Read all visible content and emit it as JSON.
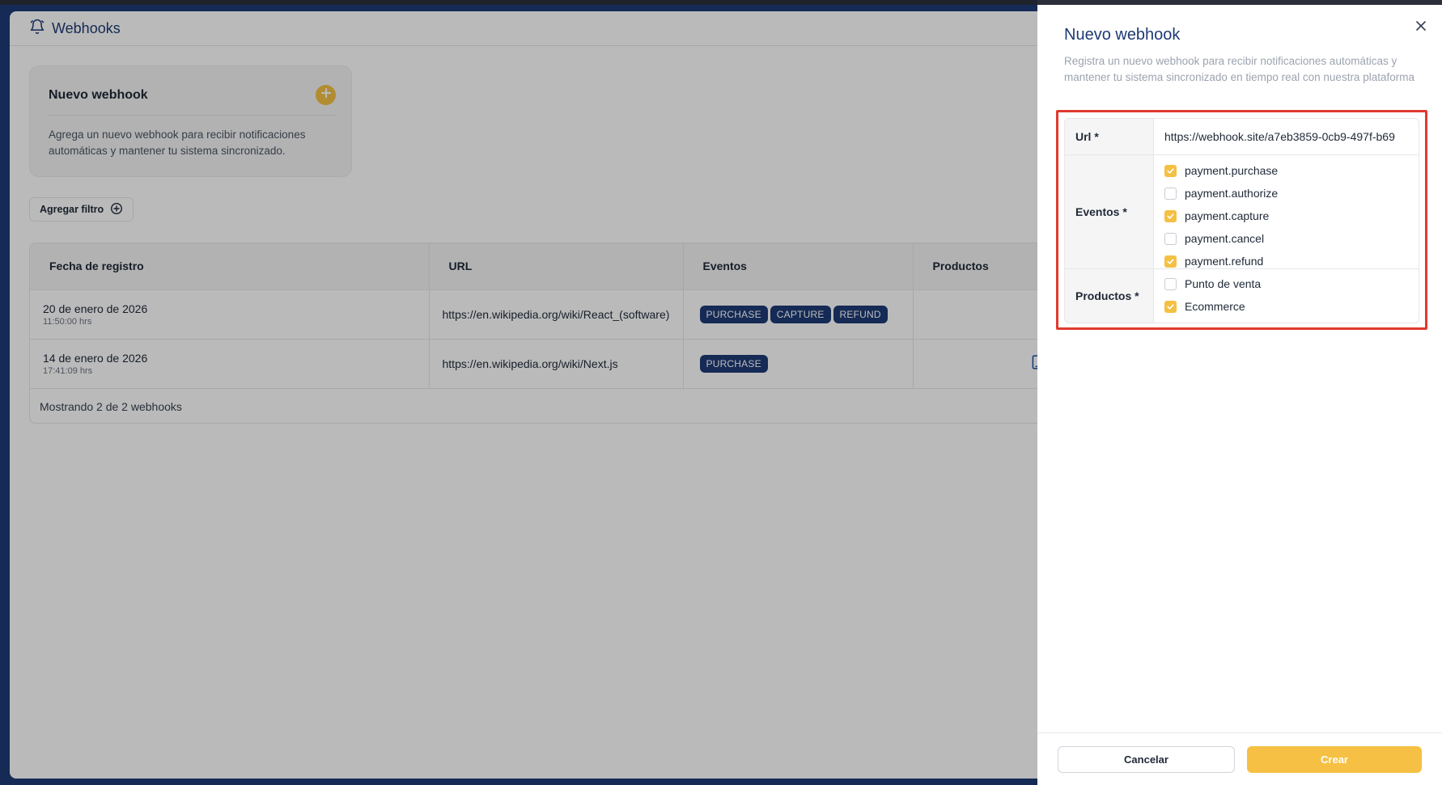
{
  "colors": {
    "brand": "#1e3a75",
    "accent": "#f5c043",
    "highlight": "#e03a2f"
  },
  "header": {
    "title": "Webhooks",
    "icon": "bell-icon"
  },
  "new_card": {
    "title": "Nuevo webhook",
    "description": "Agrega un nuevo webhook para recibir notificaciones automáticas y mantener tu sistema sincronizado.",
    "icon": "plus-icon"
  },
  "filter": {
    "label": "Agregar filtro",
    "icon": "plus-circle-icon"
  },
  "table": {
    "columns": [
      "Fecha de registro",
      "URL",
      "Eventos",
      "Productos"
    ],
    "rows": [
      {
        "date": "20 de enero de 2026",
        "time": "11:50:00 hrs",
        "url": "https://en.wikipedia.org/wiki/React_(software)",
        "events": [
          "PURCHASE",
          "CAPTURE",
          "REFUND"
        ],
        "products": [
          "cart-icon"
        ]
      },
      {
        "date": "14 de enero de 2026",
        "time": "17:41:09 hrs",
        "url": "https://en.wikipedia.org/wiki/Next.js",
        "events": [
          "PURCHASE"
        ],
        "products": [
          "phone-icon",
          "cart-icon"
        ]
      }
    ],
    "footer": "Mostrando 2 de 2 webhooks"
  },
  "drawer": {
    "title": "Nuevo webhook",
    "description": "Registra un nuevo webhook para recibir notificaciones automáticas y mantener tu sistema sincronizado en tiempo real con nuestra plataforma",
    "form": {
      "url_label": "Url *",
      "url_value": "https://webhook.site/a7eb3859-0cb9-497f-b69",
      "events_label": "Eventos *",
      "events": [
        {
          "label": "payment.purchase",
          "checked": true
        },
        {
          "label": "payment.authorize",
          "checked": false
        },
        {
          "label": "payment.capture",
          "checked": true
        },
        {
          "label": "payment.cancel",
          "checked": false
        },
        {
          "label": "payment.refund",
          "checked": true
        }
      ],
      "products_label": "Productos *",
      "products": [
        {
          "label": "Punto de venta",
          "checked": false
        },
        {
          "label": "Ecommerce",
          "checked": true
        }
      ]
    },
    "cancel_label": "Cancelar",
    "create_label": "Crear"
  }
}
